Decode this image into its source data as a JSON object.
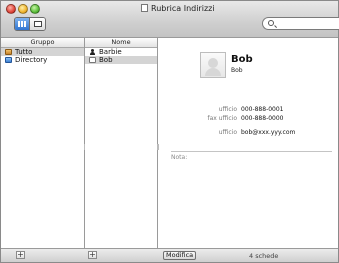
{
  "window": {
    "title": "Rubrica Indirizzi"
  },
  "toolbar": {
    "view_buttons": [
      "card-and-columns",
      "card-only"
    ],
    "search": {
      "value": "",
      "placeholder": ""
    }
  },
  "groups": {
    "header": "Gruppo",
    "items": [
      {
        "label": "Tutto",
        "icon": "address-book-icon",
        "selected": true
      },
      {
        "label": "Directory",
        "icon": "directory-icon",
        "selected": false
      }
    ]
  },
  "names": {
    "header": "Nome",
    "items": [
      {
        "label": "Barbie",
        "icon": "person-icon",
        "selected": false
      },
      {
        "label": "Bob",
        "icon": "card-icon",
        "selected": true
      }
    ]
  },
  "card": {
    "name": "Bob",
    "subname": "Bob",
    "fields": [
      {
        "label": "ufficio",
        "value": "000-888-0001"
      },
      {
        "label": "fax ufficio",
        "value": "000-888-0000"
      },
      {
        "label": "ufficio",
        "value": "bob@xxx.yyy.com"
      }
    ],
    "note_label": "Nota:"
  },
  "bottom": {
    "add_group": "+",
    "add_person": "+",
    "edit_button": "Modifica",
    "count": "4 schede"
  }
}
